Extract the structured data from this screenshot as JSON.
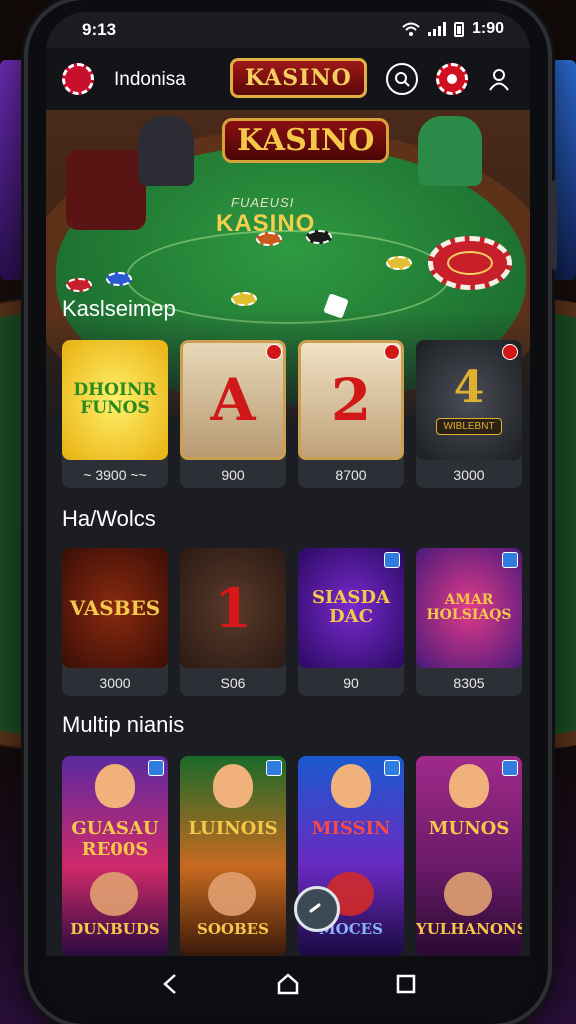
{
  "status_bar": {
    "time": "9:13",
    "clock": "1:90"
  },
  "header": {
    "region_label": "Indonisa",
    "logo_text": "KASINO",
    "icons": [
      "chip-icon",
      "search-icon",
      "poker-chip-icon",
      "user-icon"
    ]
  },
  "hero": {
    "logo_text": "KASINO",
    "subtitle": "FUAEUSI",
    "title": "KASINO"
  },
  "sections": {
    "s1": {
      "title": "Kaslseimep",
      "cards": [
        {
          "text": "DHOINR FUNOS",
          "value": "~ 3900 ~~"
        },
        {
          "text": "A",
          "value": "900"
        },
        {
          "text": "2",
          "value": "8700"
        },
        {
          "text": "4",
          "sub": "WIBLEBNT",
          "value": "3000"
        }
      ]
    },
    "s2": {
      "title": "Ha/Wolcs",
      "cards": [
        {
          "text": "VASBES",
          "value": "3000"
        },
        {
          "text": "1",
          "value": "S06"
        },
        {
          "text": "SIASDA DAC",
          "value": "90"
        },
        {
          "text": "AMAR HOLSIAQS",
          "value": "8305"
        }
      ]
    },
    "s3": {
      "title": "Multip nianis",
      "cards": [
        {
          "top": "GUASAU RE00S",
          "bottom": "DUNBUDS"
        },
        {
          "top": "LUINOIS",
          "bottom": "SOOBES"
        },
        {
          "top": "MISSIN",
          "bottom": "MOCES"
        },
        {
          "top": "MUNOS",
          "bottom": "YULHANONS"
        }
      ]
    }
  },
  "colors": {
    "felt": "#1f7a34",
    "accent_red": "#c8102e",
    "gold": "#f5c84a",
    "card_bg": "#2c2f36"
  }
}
